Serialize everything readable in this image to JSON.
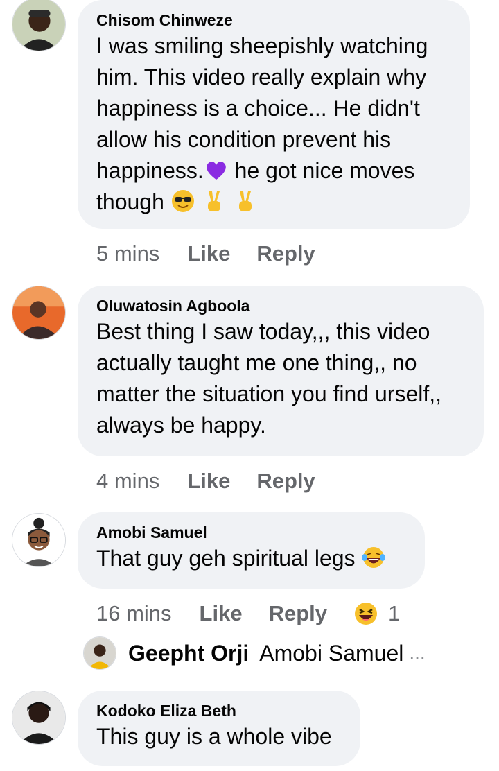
{
  "comments": [
    {
      "author": "Chisom Chinweze",
      "lines": [
        "I was smiling sheepishly watching",
        "him. This video really explain why",
        "happiness is a choice... He didn't",
        "allow his condition prevent his"
      ],
      "line5_pre": "happiness.",
      "line5_post": " he got nice moves",
      "line6_pre": "though ",
      "time": "5 mins",
      "like": "Like",
      "reply": "Reply"
    },
    {
      "author": "Oluwatosin Agboola",
      "lines": [
        "Best thing I saw today,,, this video",
        "actually taught me one thing,, no",
        "matter the situation you find urself,,",
        "always be happy."
      ],
      "time": "4 mins",
      "like": "Like",
      "reply": "Reply"
    },
    {
      "author": "Amobi Samuel",
      "text": "That guy geh spiritual legs ",
      "time": "16 mins",
      "like": "Like",
      "reply": "Reply",
      "reaction_count": "1",
      "reply_preview": {
        "author": "Geepht Orji",
        "snippet": "Amobi Samuel",
        "ellipsis": "..."
      }
    },
    {
      "author": "Kodoko Eliza Beth",
      "text": "This guy is a whole vibe"
    }
  ],
  "colors": {
    "bubble": "#f0f2f5",
    "meta": "#65676b"
  }
}
